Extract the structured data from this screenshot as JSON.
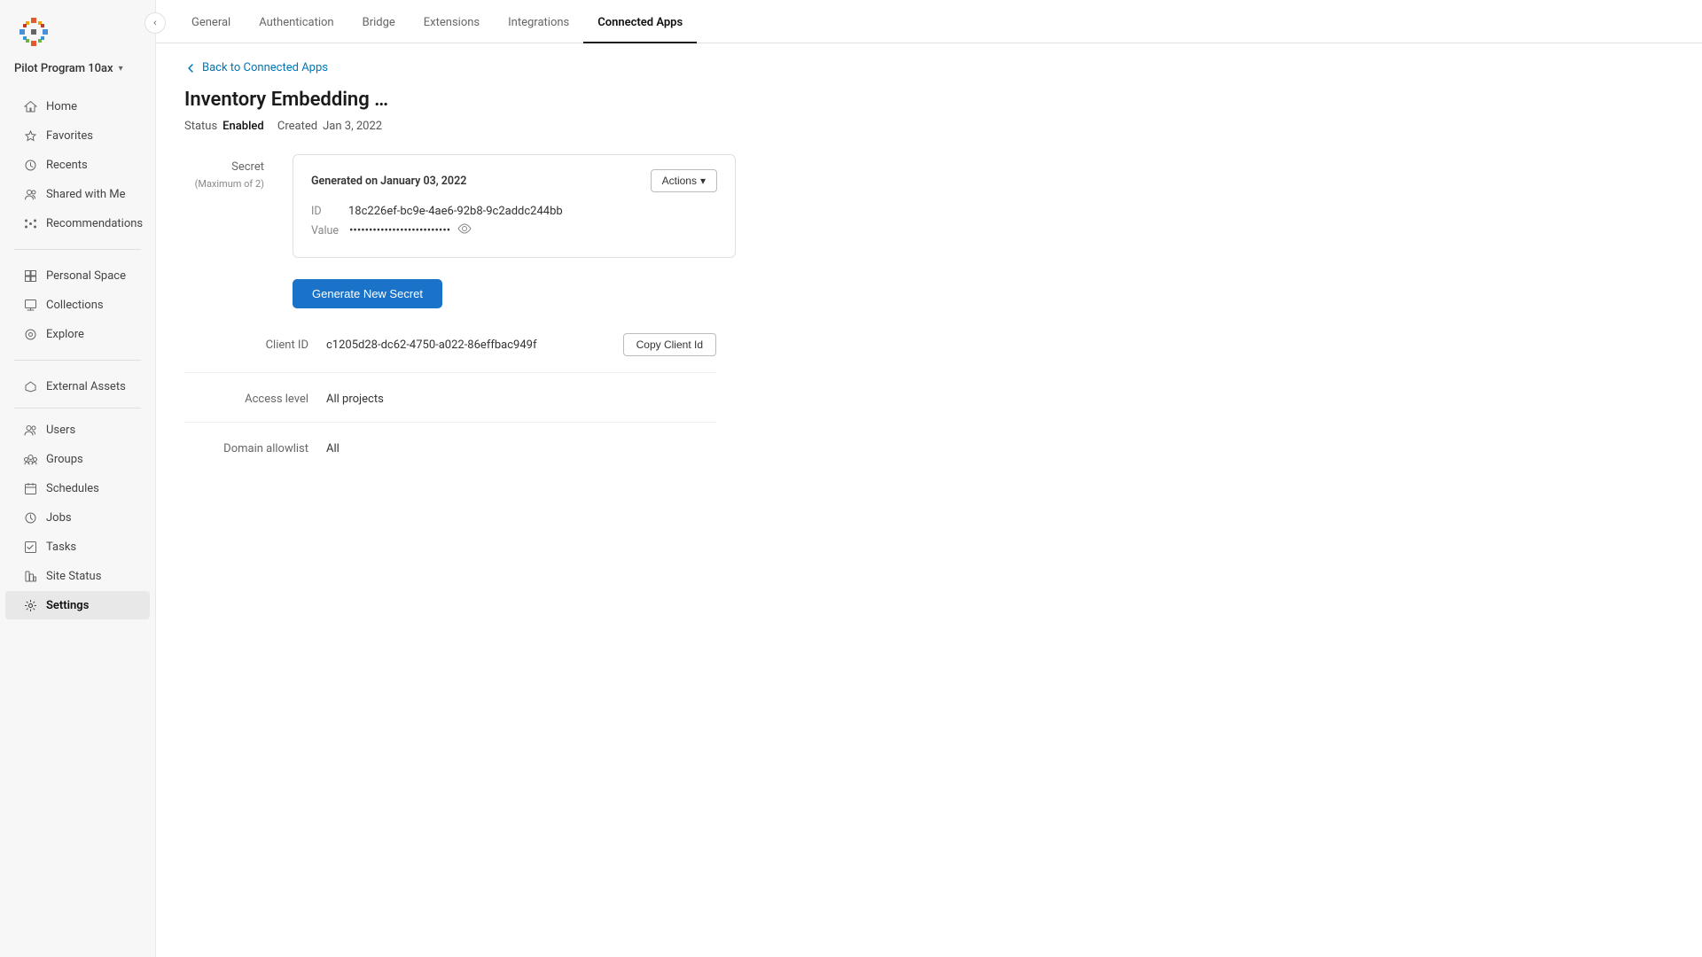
{
  "sidebar": {
    "workspace_name": "Pilot Program 10ax",
    "items_top": [
      {
        "id": "home",
        "label": "Home",
        "icon": "🏠"
      },
      {
        "id": "favorites",
        "label": "Favorites",
        "icon": "☆"
      },
      {
        "id": "recents",
        "label": "Recents",
        "icon": "🕐"
      },
      {
        "id": "shared-with-me",
        "label": "Shared with Me",
        "icon": "👤"
      },
      {
        "id": "recommendations",
        "label": "Recommendations",
        "icon": "✦"
      }
    ],
    "items_mid": [
      {
        "id": "personal-space",
        "label": "Personal Space",
        "icon": "⊞"
      },
      {
        "id": "collections",
        "label": "Collections",
        "icon": "⊡"
      },
      {
        "id": "explore",
        "label": "Explore",
        "icon": "◎"
      }
    ],
    "items_bottom": [
      {
        "id": "external-assets",
        "label": "External Assets",
        "icon": "⬡"
      },
      {
        "id": "users",
        "label": "Users",
        "icon": "👥"
      },
      {
        "id": "groups",
        "label": "Groups",
        "icon": "⚇"
      },
      {
        "id": "schedules",
        "label": "Schedules",
        "icon": "📅"
      },
      {
        "id": "jobs",
        "label": "Jobs",
        "icon": "⚙"
      },
      {
        "id": "tasks",
        "label": "Tasks",
        "icon": "☑"
      },
      {
        "id": "site-status",
        "label": "Site Status",
        "icon": "◈"
      },
      {
        "id": "settings",
        "label": "Settings",
        "icon": "⚙"
      }
    ]
  },
  "tabs": [
    {
      "id": "general",
      "label": "General",
      "active": false
    },
    {
      "id": "authentication",
      "label": "Authentication",
      "active": false
    },
    {
      "id": "bridge",
      "label": "Bridge",
      "active": false
    },
    {
      "id": "extensions",
      "label": "Extensions",
      "active": false
    },
    {
      "id": "integrations",
      "label": "Integrations",
      "active": false
    },
    {
      "id": "connected-apps",
      "label": "Connected Apps",
      "active": true
    }
  ],
  "back_link": "Back to Connected Apps",
  "page_title": "Inventory Embedding …",
  "status_label": "Status",
  "status_value": "Enabled",
  "created_label": "Created",
  "created_value": "Jan 3, 2022",
  "secret": {
    "section_label": "Secret",
    "max_label": "(Maximum of 2)",
    "card": {
      "generated_text": "Generated on January 03, 2022",
      "actions_label": "Actions",
      "id_label": "ID",
      "id_value": "18c226ef-bc9e-4ae6-92b8-9c2addc244bb",
      "value_label": "Value",
      "value_masked": "••••••••••••••••••••••••••",
      "generate_btn_label": "Generate New Secret"
    }
  },
  "client_id": {
    "label": "Client ID",
    "value": "c1205d28-dc62-4750-a022-86effbac949f",
    "copy_btn_label": "Copy Client Id"
  },
  "access_level": {
    "label": "Access level",
    "value": "All projects"
  },
  "domain_allowlist": {
    "label": "Domain allowlist",
    "value": "All"
  }
}
